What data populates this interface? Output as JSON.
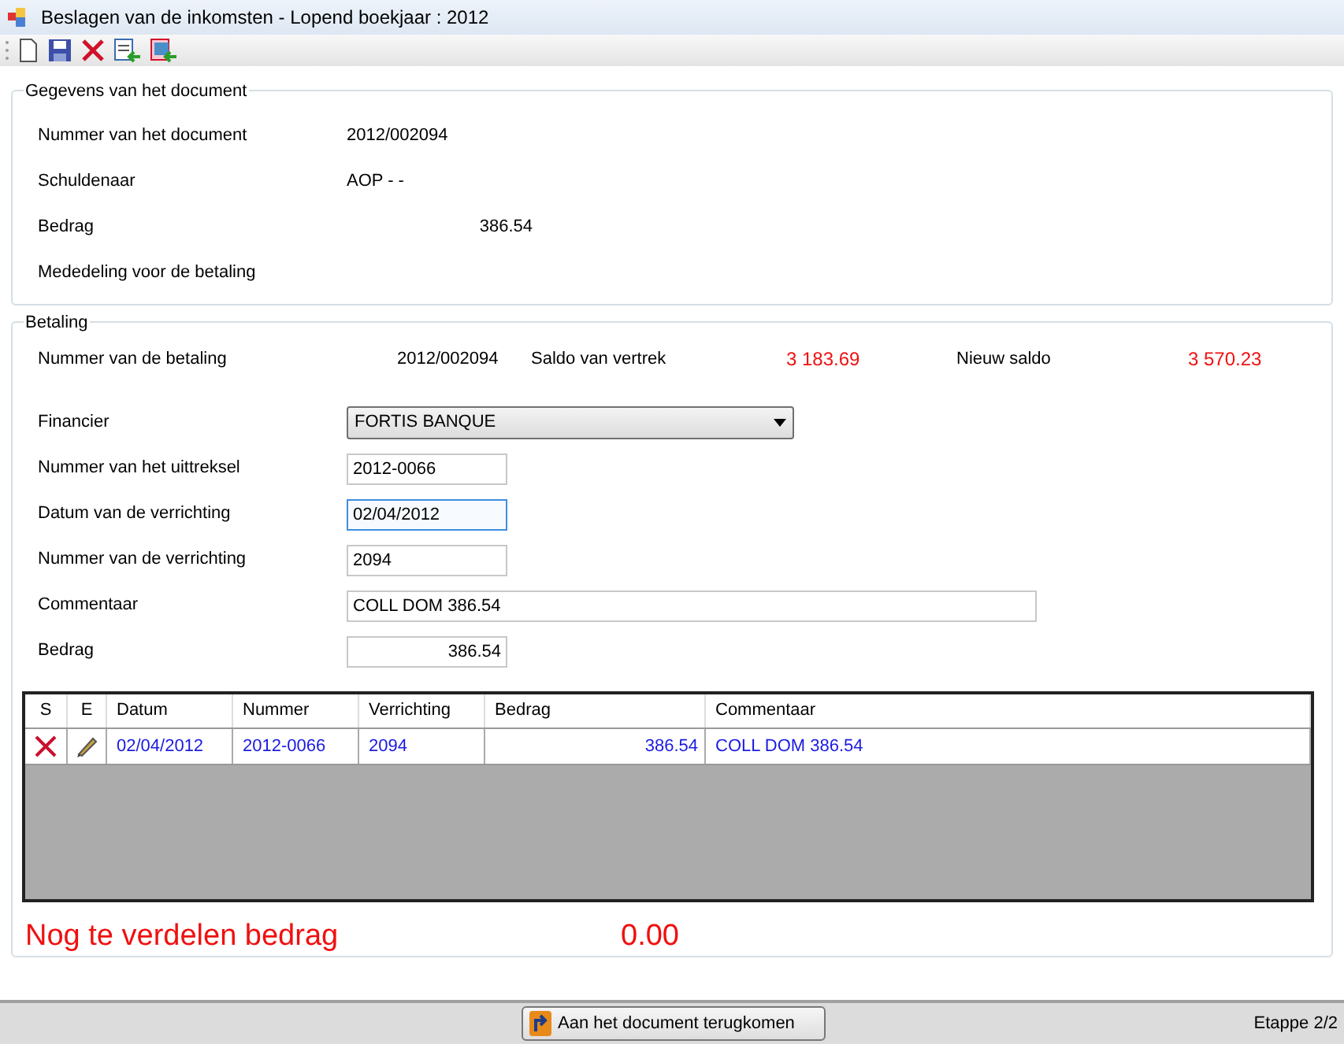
{
  "window": {
    "title": "Beslagen van de inkomsten - Lopend boekjaar : 2012"
  },
  "document_section": {
    "title": "Gegevens van het document",
    "fields": [
      {
        "label": "Nummer van het document",
        "value": "2012/002094",
        "kind": "text"
      },
      {
        "label": "Schuldenaar",
        "value": "AOP - -",
        "kind": "text"
      },
      {
        "label": "Bedrag",
        "value": "386.54",
        "kind": "amount"
      },
      {
        "label": "Mededeling voor de betaling",
        "kind": "text"
      }
    ]
  },
  "payment_section": {
    "title": "Betaling",
    "summary": {
      "label": "Nummer van de betaling",
      "value": "2012/002094",
      "start_label": "Saldo  van vertrek",
      "start_value": "3 183.69",
      "new_label": "Nieuw  saldo",
      "new_value": "3 570.23"
    },
    "fields": [
      {
        "label": "Financier",
        "kind": "select",
        "value": "FORTIS BANQUE"
      },
      {
        "label": "Nummer van het uittreksel",
        "kind": "text",
        "value": "2012-0066",
        "focused": false
      },
      {
        "label": "Datum van de verrichting",
        "kind": "text",
        "value": "02/04/2012",
        "focused": true
      },
      {
        "label": "Nummer van de verrichting",
        "kind": "text",
        "value": "2094",
        "focused": false
      },
      {
        "label": "Commentaar",
        "kind": "wide",
        "value": "COLL DOM 386.54",
        "focused": false
      },
      {
        "label": "Bedrag",
        "kind": "amount",
        "value": "386.54",
        "focused": false
      }
    ],
    "table": {
      "columns": [
        "S",
        "E",
        "Datum",
        "Nummer",
        "Verrichting",
        "Bedrag",
        "Commentaar"
      ],
      "rows": [
        {
          "datum": "02/04/2012",
          "nummer": "2012-0066",
          "verrichting": "2094",
          "bedrag": "386.54",
          "commentaar": "COLL DOM 386.54"
        }
      ]
    },
    "remaining": {
      "label": "Nog te verdelen bedrag",
      "value": "0.00"
    }
  },
  "footer": {
    "button": "Aan het document terugkomen",
    "step": "Etappe 2/2"
  }
}
